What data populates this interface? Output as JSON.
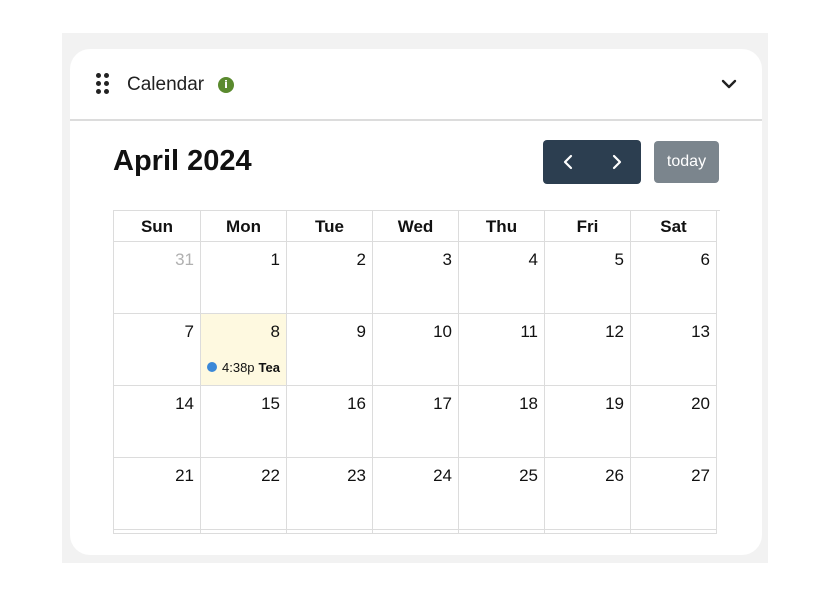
{
  "widget": {
    "title": "Calendar",
    "info_icon": "info-icon",
    "drag_icon": "drag-handle-icon",
    "collapse_icon": "chevron-down-icon",
    "accent_info": "#5a8a2e"
  },
  "calendar": {
    "title": "April 2024",
    "today_label": "today",
    "nav_color": "#2c3e50",
    "today_button_color": "#7b858d",
    "weekdays": [
      "Sun",
      "Mon",
      "Tue",
      "Wed",
      "Thu",
      "Fri",
      "Sat"
    ],
    "weeks": [
      [
        {
          "d": "31",
          "other": true
        },
        {
          "d": "1"
        },
        {
          "d": "2"
        },
        {
          "d": "3"
        },
        {
          "d": "4"
        },
        {
          "d": "5"
        },
        {
          "d": "6"
        }
      ],
      [
        {
          "d": "7"
        },
        {
          "d": "8",
          "today": true,
          "event": {
            "time": "4:38p",
            "title": "Tea"
          }
        },
        {
          "d": "9"
        },
        {
          "d": "10"
        },
        {
          "d": "11"
        },
        {
          "d": "12"
        },
        {
          "d": "13"
        }
      ],
      [
        {
          "d": "14"
        },
        {
          "d": "15"
        },
        {
          "d": "16"
        },
        {
          "d": "17"
        },
        {
          "d": "18"
        },
        {
          "d": "19"
        },
        {
          "d": "20"
        }
      ],
      [
        {
          "d": "21"
        },
        {
          "d": "22"
        },
        {
          "d": "23"
        },
        {
          "d": "24"
        },
        {
          "d": "25"
        },
        {
          "d": "26"
        },
        {
          "d": "27"
        }
      ]
    ],
    "today_highlight_color": "#fef9e0",
    "event_color": "#3b88d8"
  }
}
